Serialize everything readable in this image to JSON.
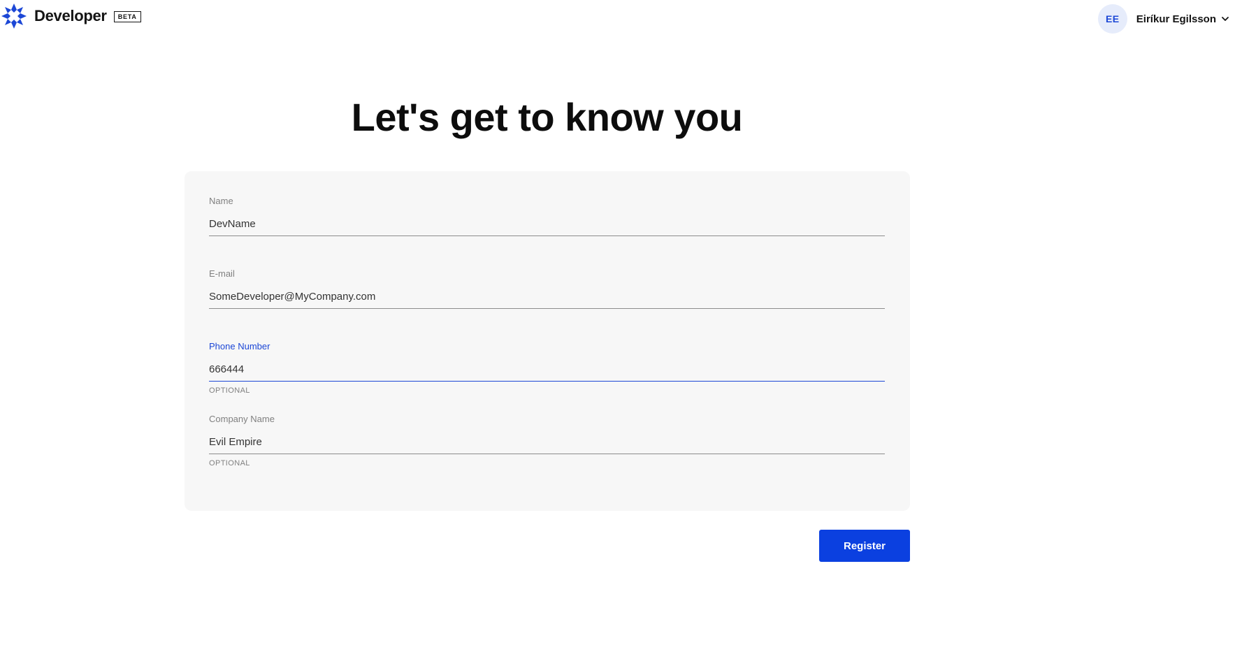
{
  "header": {
    "brand_name": "Developer",
    "badge": "BETA",
    "user": {
      "initials": "EE",
      "name": "Eiríkur Egilsson"
    }
  },
  "main": {
    "title": "Let's get to know you",
    "form": {
      "fields": [
        {
          "label": "Name",
          "value": "DevName",
          "hint": ""
        },
        {
          "label": "E-mail",
          "value": "SomeDeveloper@MyCompany.com",
          "hint": ""
        },
        {
          "label": "Phone Number",
          "value": "666444",
          "hint": "OPTIONAL",
          "focused": true
        },
        {
          "label": "Company Name",
          "value": "Evil Empire",
          "hint": "OPTIONAL"
        }
      ]
    },
    "register_label": "Register"
  },
  "colors": {
    "accent": "#0b40e0",
    "focus": "#1c47d6",
    "card_background": "#f7f7f7",
    "avatar_background": "#e6ecfb"
  },
  "icons": {
    "logo": "star-quilt-logo-icon",
    "user_menu": "chevron-down-icon"
  }
}
